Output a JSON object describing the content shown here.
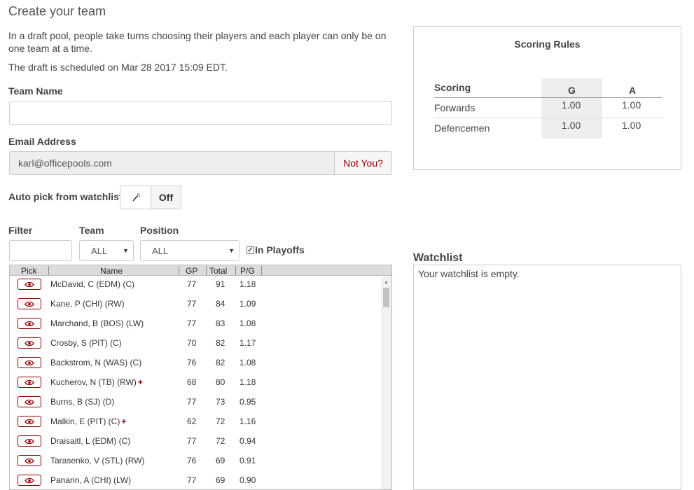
{
  "page": {
    "title": "Create your team",
    "intro": "In a draft pool, people take turns choosing their players and each player can only be on one team at a time.",
    "draft_date": "The draft is scheduled on Mar 28 2017 15:09 EDT."
  },
  "form": {
    "team_name_label": "Team Name",
    "team_name_value": "",
    "email_label": "Email Address",
    "email_value": "karl@officepools.com",
    "not_you": "Not You?",
    "autopick_label": "Auto pick from watchlist",
    "autopick_state": "Off"
  },
  "filters": {
    "filter_label": "Filter",
    "team_label": "Team",
    "team_value": "ALL",
    "position_label": "Position",
    "position_value": "ALL",
    "in_playoffs_label": "In Playoffs",
    "in_playoffs_checked": true
  },
  "players_table": {
    "columns": [
      "Pick",
      "Name",
      "GP",
      "Total",
      "P/G"
    ],
    "rows": [
      {
        "name": "McDavid, C (EDM) (C)",
        "gp": "77",
        "total": "91",
        "pg": "1.18",
        "plus": false
      },
      {
        "name": "Kane, P (CHI) (RW)",
        "gp": "77",
        "total": "84",
        "pg": "1.09",
        "plus": false
      },
      {
        "name": "Marchand, B (BOS) (LW)",
        "gp": "77",
        "total": "83",
        "pg": "1.08",
        "plus": false
      },
      {
        "name": "Crosby, S (PIT) (C)",
        "gp": "70",
        "total": "82",
        "pg": "1.17",
        "plus": false
      },
      {
        "name": "Backstrom, N (WAS) (C)",
        "gp": "76",
        "total": "82",
        "pg": "1.08",
        "plus": false
      },
      {
        "name": "Kucherov, N (TB) (RW)",
        "gp": "68",
        "total": "80",
        "pg": "1.18",
        "plus": true
      },
      {
        "name": "Burns, B (SJ) (D)",
        "gp": "77",
        "total": "73",
        "pg": "0.95",
        "plus": false
      },
      {
        "name": "Malkin, E (PIT) (C)",
        "gp": "62",
        "total": "72",
        "pg": "1.16",
        "plus": true
      },
      {
        "name": "Draisaitl, L (EDM) (C)",
        "gp": "77",
        "total": "72",
        "pg": "0.94",
        "plus": false
      },
      {
        "name": "Tarasenko, V (STL) (RW)",
        "gp": "76",
        "total": "69",
        "pg": "0.91",
        "plus": false
      },
      {
        "name": "Panarin, A (CHI) (LW)",
        "gp": "77",
        "total": "69",
        "pg": "0.90",
        "plus": false
      }
    ]
  },
  "scoring": {
    "title": "Scoring Rules",
    "header": "Scoring",
    "col_g": "G",
    "col_a": "A",
    "rows": [
      {
        "label": "Forwards",
        "g": "1.00",
        "a": "1.00"
      },
      {
        "label": "Defencemen",
        "g": "1.00",
        "a": "1.00"
      }
    ]
  },
  "watchlist": {
    "title": "Watchlist",
    "empty_text": "Your watchlist is empty."
  },
  "colors": {
    "accent": "#8b0000",
    "header_bg": "#dcdcdc"
  }
}
